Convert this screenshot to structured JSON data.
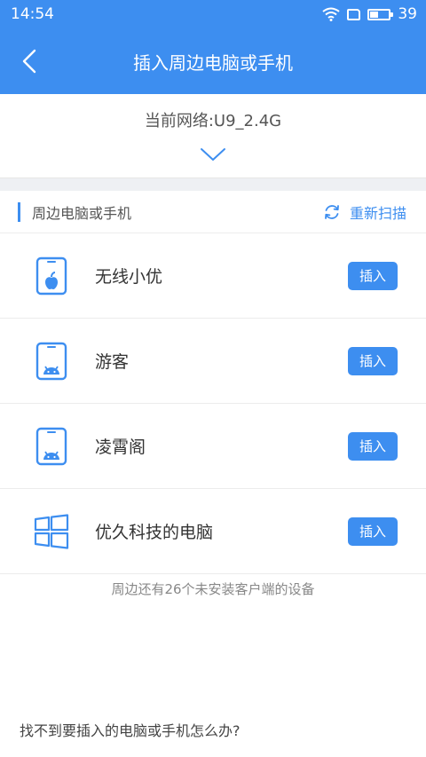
{
  "status": {
    "time": "14:54",
    "battery": "39",
    "battery_fraction": 0.39
  },
  "header": {
    "title": "插入周边电脑或手机"
  },
  "network": {
    "label": "当前网络:U9_2.4G"
  },
  "section": {
    "title": "周边电脑或手机",
    "rescan": "重新扫描"
  },
  "devices": [
    {
      "name": "无线小优",
      "icon": "apple-tablet-icon",
      "button": "插入"
    },
    {
      "name": "游客",
      "icon": "android-tablet-icon",
      "button": "插入"
    },
    {
      "name": "凌霄阁",
      "icon": "android-tablet-icon",
      "button": "插入"
    },
    {
      "name": "优久科技的电脑",
      "icon": "windows-icon",
      "button": "插入"
    }
  ],
  "footer": {
    "note": "周边还有26个未安装客户端的设备"
  },
  "help": {
    "text": "找不到要插入的电脑或手机怎么办?"
  },
  "colors": {
    "accent": "#3d8ef0",
    "background": "#ffffff",
    "band": "#eef0f3"
  }
}
